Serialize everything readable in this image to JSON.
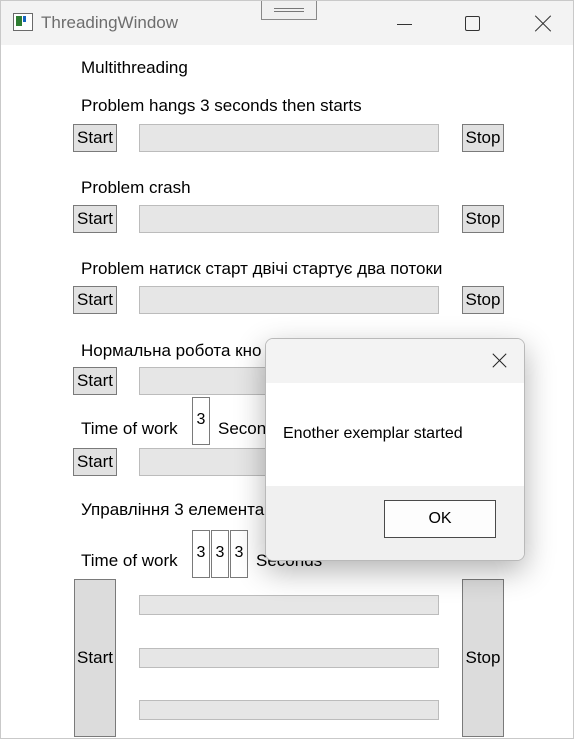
{
  "window": {
    "title": "ThreadingWindow",
    "controls": [
      "minimize-icon",
      "maximize-icon",
      "close-icon"
    ]
  },
  "main": {
    "heading": "Multithreading",
    "start_label": "Start",
    "stop_label": "Stop",
    "sections": [
      {
        "label": "Problem hangs 3 seconds then starts",
        "progress": 0
      },
      {
        "label": "Problem crash",
        "progress": 0
      },
      {
        "label": "Problem натиск старт двічі стартує два потоки",
        "progress": 0
      },
      {
        "label": "Нормальна робота кно",
        "progress": 0
      }
    ],
    "timed": {
      "label": "Time of work",
      "value": "3",
      "unit": "Secon",
      "progress": 0
    },
    "multi": {
      "label": "Управління 3 елемента",
      "time_label": "Time of work",
      "values": [
        "3",
        "3",
        "3"
      ],
      "unit": "Seconds",
      "progress": [
        0,
        0,
        0
      ]
    }
  },
  "dialog": {
    "message": "Enother exemplar started",
    "ok_label": "OK"
  }
}
